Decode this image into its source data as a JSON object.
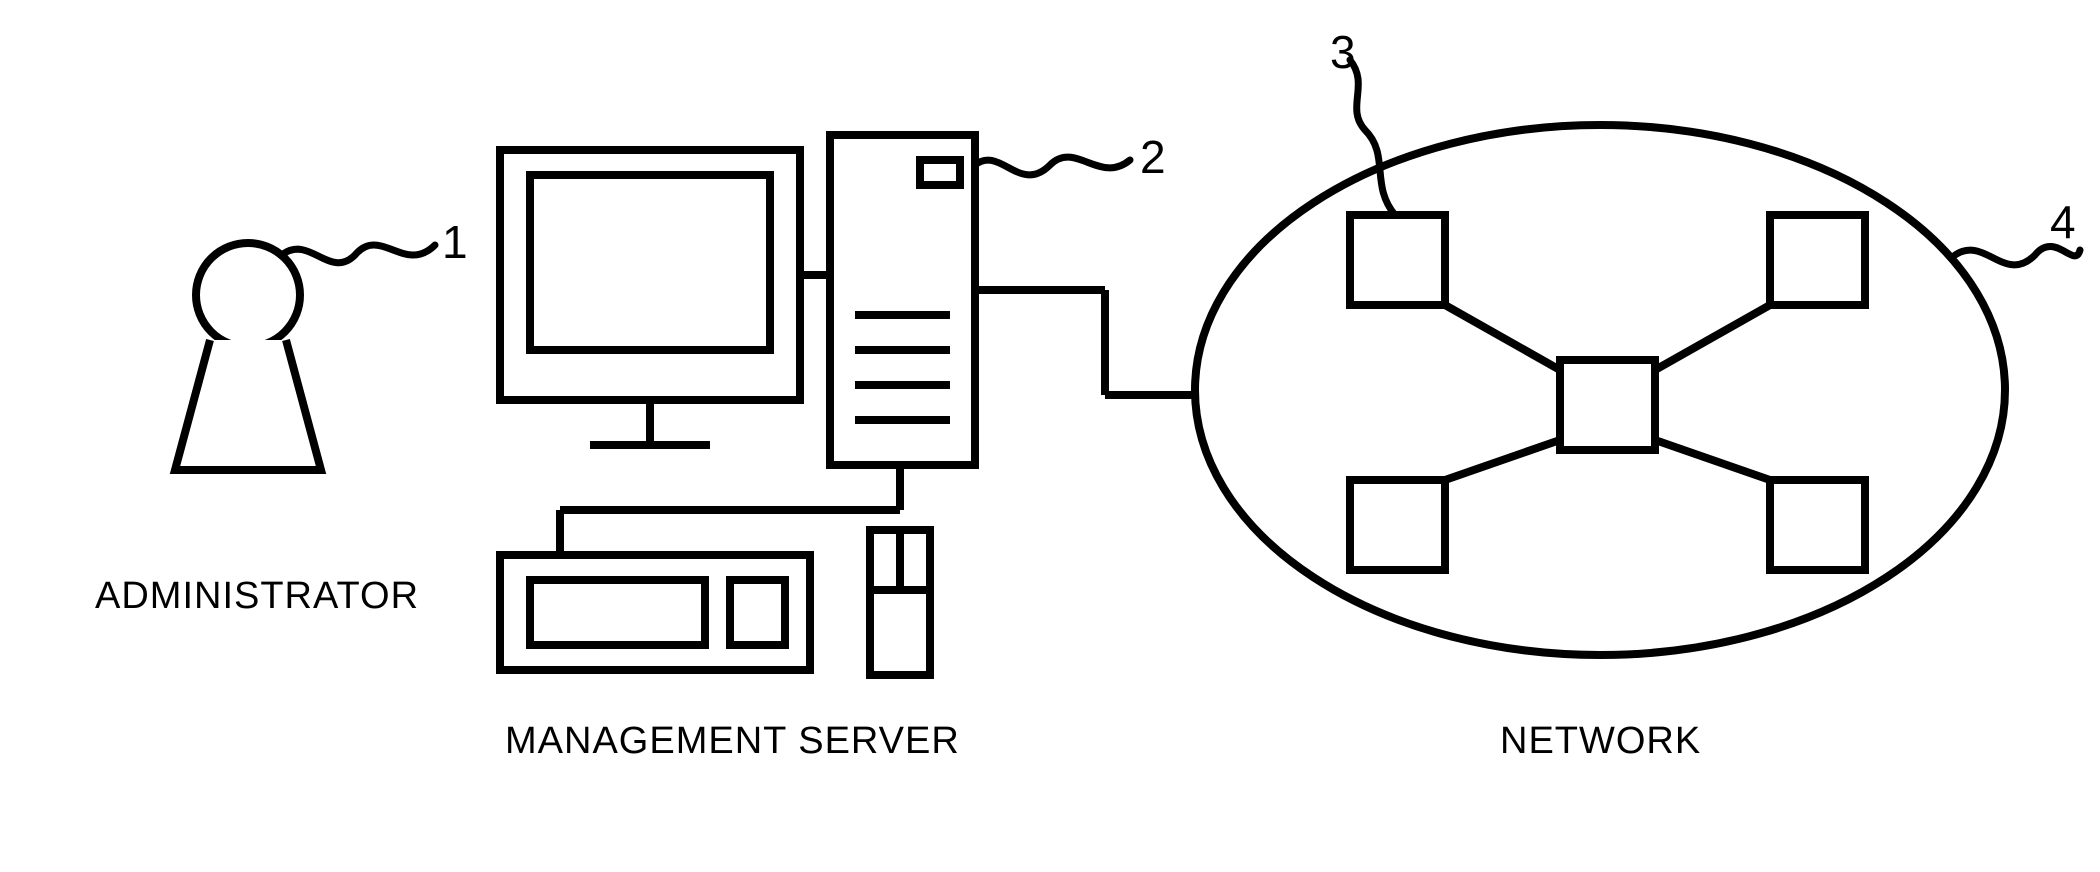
{
  "labels": {
    "administrator": "ADMINISTRATOR",
    "management_server": "MANAGEMENT SERVER",
    "network": "NETWORK"
  },
  "refs": {
    "r1": "1",
    "r2": "2",
    "r3": "3",
    "r4": "4"
  }
}
